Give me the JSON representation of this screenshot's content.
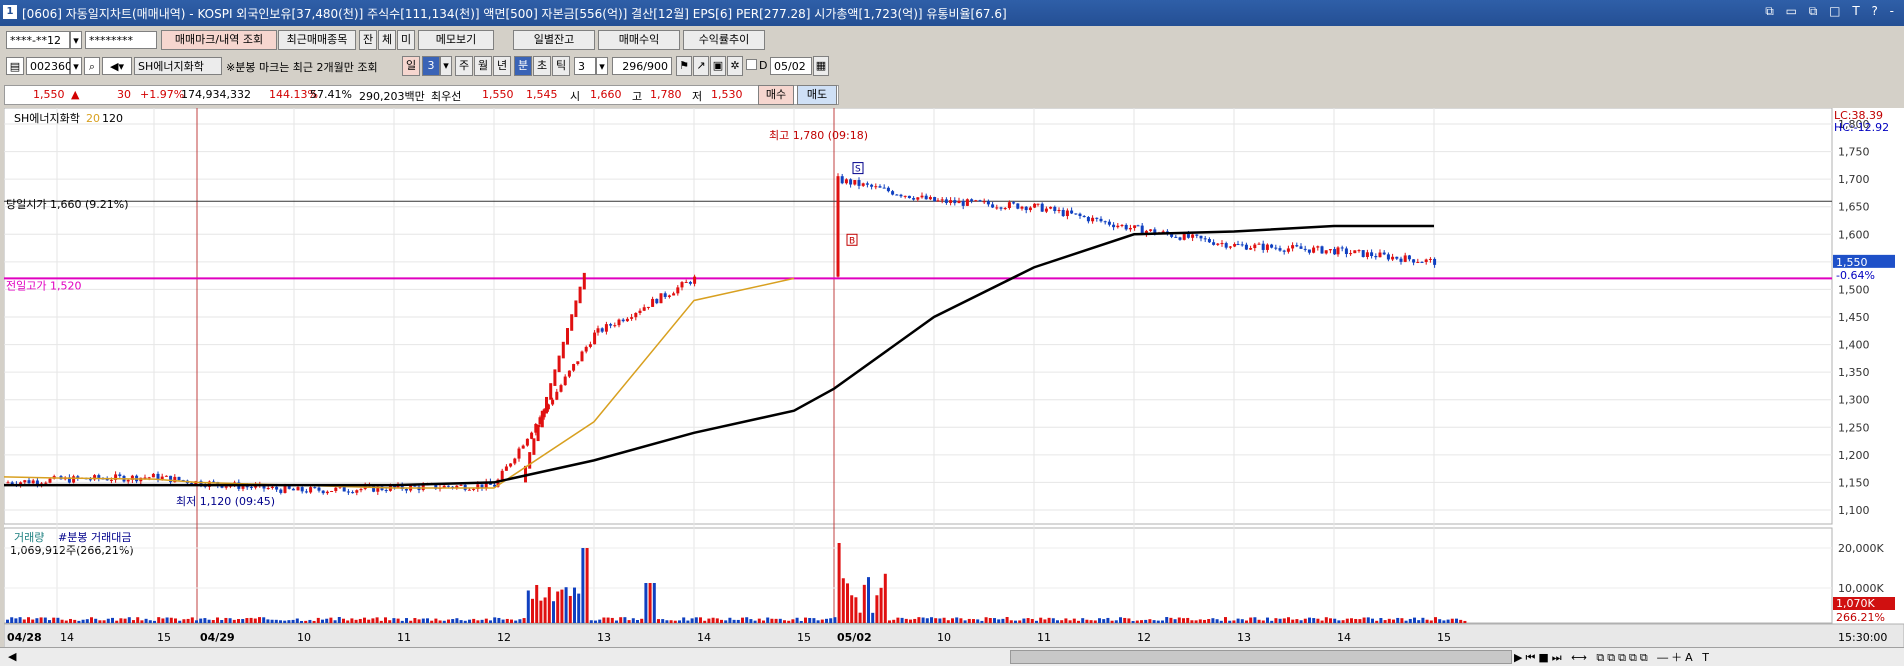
{
  "titlebar": {
    "icon_text": "1",
    "title": "[0606] 자동일지차트(매매내역) - KOSPI 외국인보유[37,480(천)] 주식수[111,134(천)] 액면[500] 자본금[556(억)] 결산[12월] EPS[6] PER[277.28] 시가총액[1,723(억)] 유통비율[67.6]",
    "win_buttons": "⧉ ▭ ⧉ □ T ? -"
  },
  "toolbar1": {
    "account": "****-**12",
    "password": "********",
    "btn_trade_mark": "매매마크/내역 조회",
    "btn_recent": "최근매매종목",
    "btn_balance": "잔",
    "btn_body": "체",
    "btn_unfilled": "미",
    "btn_memo": "메모보기",
    "btn_daily": "일별잔고",
    "btn_profit": "매매수익",
    "btn_rate": "수익률추이"
  },
  "toolbar2": {
    "code": "002360",
    "stock_name": "SH에너지화학",
    "note": "※분봉 마크는 최근 2개월만 조회",
    "period_day": "일",
    "period_value": "3",
    "period_week": "주",
    "period_month": "월",
    "period_year": "년",
    "period_min": "분",
    "period_sec": "초",
    "period_tick": "틱",
    "interval": "3",
    "count": "296/900",
    "d_label": "D",
    "date": "05/02"
  },
  "quote": {
    "price": "1,550",
    "arrow": "▲",
    "change": "30",
    "change_rate": "+1.97%",
    "volume": "174,934,332",
    "vol_rate": "144.13%",
    "turnover": "57.41%",
    "amount": "290,203백만",
    "best_label": "최우선",
    "ask": "1,550",
    "bid": "1,545",
    "open_label": "시",
    "open": "1,660",
    "high_label": "고",
    "high": "1,780",
    "low_label": "저",
    "low": "1,530",
    "buy_btn": "매수",
    "sell_btn": "매도"
  },
  "chart": {
    "legend_name": "SH에너지화학",
    "legend_ma1": "20",
    "legend_ma2": "120",
    "lc_label": "LC:38.39",
    "hc_label": "HC:-12.92",
    "open_line_label": "당일시가 1,660 (9.21%)",
    "prev_high_label": "전일고가 1,520",
    "high_annot": "최고 1,780 (09:18)",
    "low_annot": "최저 1,120 (09:45)",
    "price_tag": "1,550",
    "price_tag_pct": "-0.64%",
    "vol_legend1": "거래량",
    "vol_legend2": "#분봉 거래대금",
    "vol_info": "1,069,912주(266,21%)",
    "vol_tag": "1,070K",
    "vol_tag_pct": "266.21%",
    "time_label": "15:30:00",
    "buy_marker": "B",
    "sell_marker": "S",
    "colors": {
      "up": "#e01010",
      "down": "#1040c0",
      "ma20": "#d8a020",
      "ma120": "#000000",
      "prev_high": "#e000c0"
    }
  },
  "chart_data": {
    "type": "candlestick",
    "title": "",
    "y_ticks": [
      "1,800",
      "1,750",
      "1,700",
      "1,650",
      "1,600",
      "1,550",
      "1,500",
      "1,450",
      "1,400",
      "1,350",
      "1,300",
      "1,250",
      "1,200",
      "1,150",
      "1,100"
    ],
    "ylim": [
      1100,
      1800
    ],
    "vol_ticks": [
      "20,000K",
      "10,000K"
    ],
    "x_labels": [
      "04/28",
      "14",
      "15",
      "04/29",
      "10",
      "11",
      "12",
      "13",
      "14",
      "15",
      "05/02",
      "10",
      "11",
      "12",
      "13",
      "14",
      "15"
    ],
    "x_label_bold": [
      "04/28",
      "04/29",
      "05/02"
    ],
    "x": [
      "04/28 13",
      "04/28 14",
      "04/28 15",
      "04/29 09",
      "04/29 10",
      "04/29 11",
      "04/29 12",
      "04/29 13",
      "04/29 14",
      "04/29 15",
      "05/02 09",
      "05/02 10",
      "05/02 11",
      "05/02 12",
      "05/02 13",
      "05/02 14",
      "05/02 15"
    ],
    "close": [
      1150,
      1155,
      1160,
      1150,
      1135,
      1140,
      1145,
      1420,
      1520,
      1520,
      1700,
      1660,
      1650,
      1610,
      1580,
      1570,
      1550
    ],
    "ma20": [
      1160,
      1158,
      1156,
      1150,
      1145,
      1140,
      1140,
      1260,
      1480,
      1520,
      1560,
      1665,
      1650,
      1625,
      1590,
      1580,
      1550
    ],
    "ma120": [
      1145,
      1145,
      1145,
      1145,
      1145,
      1145,
      1150,
      1190,
      1240,
      1280,
      1320,
      1450,
      1540,
      1600,
      1605,
      1615,
      1615
    ],
    "open_price": 1660,
    "prev_high": 1520,
    "high": 1780,
    "low": 1120
  }
}
